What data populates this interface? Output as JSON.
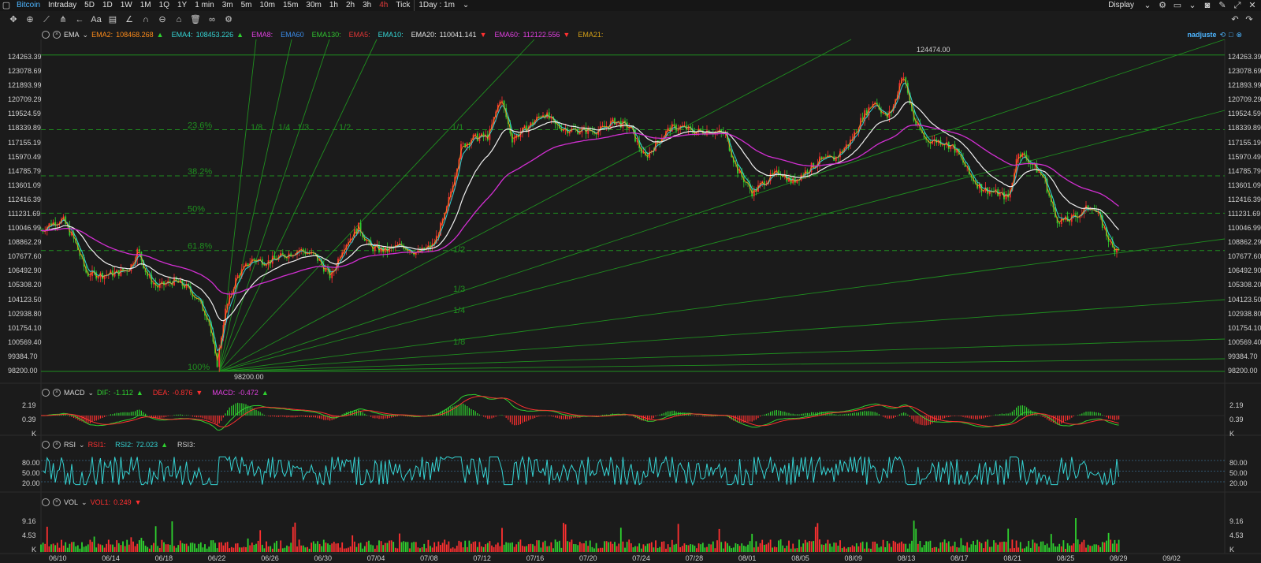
{
  "topbar": {
    "title": "Bitcoin",
    "intervals": [
      "Intraday",
      "5D",
      "1D",
      "1W",
      "1M",
      "1Q",
      "1Y",
      "1 min",
      "3m",
      "5m",
      "10m",
      "15m",
      "30m",
      "1h",
      "2h",
      "3h",
      "4h",
      "Tick"
    ],
    "active_interval": "4h",
    "range_select": "1Day : 1m",
    "display_label": "Display"
  },
  "main_indicator": {
    "name": "EMA",
    "items": [
      {
        "label": "EMA2:",
        "value": "108468.268",
        "color": "#ff8c1a",
        "arrow": "▲"
      },
      {
        "label": "EMA4:",
        "value": "108453.226",
        "color": "#35d3d3",
        "arrow": "▲"
      },
      {
        "label": "EMA8:",
        "value": "",
        "color": "#e040e0",
        "arrow": ""
      },
      {
        "label": "EMA60",
        "value": "",
        "color": "#3a8be8",
        "arrow": ""
      },
      {
        "label": "EMA130:",
        "value": "",
        "color": "#30c030",
        "arrow": ""
      },
      {
        "label": "EMA5:",
        "value": "",
        "color": "#e03535",
        "arrow": ""
      },
      {
        "label": "EMA10:",
        "value": "",
        "color": "#35d3d3",
        "arrow": ""
      },
      {
        "label": "EMA20:",
        "value": "110041.141",
        "color": "#e0e0e0",
        "arrow": "▼"
      },
      {
        "label": "EMA60:",
        "value": "112122.556",
        "color": "#e040e0",
        "arrow": "▼"
      },
      {
        "label": "EMA21:",
        "value": "",
        "color": "#d4a017",
        "arrow": ""
      }
    ],
    "user": "nadjuste"
  },
  "price_axis": [
    "124263.39",
    "123078.69",
    "121893.99",
    "120709.29",
    "119524.59",
    "118339.89",
    "117155.19",
    "115970.49",
    "114785.79",
    "113601.09",
    "112416.39",
    "111231.69",
    "110046.99",
    "108862.29",
    "107677.60",
    "106492.90",
    "105308.20",
    "104123.50",
    "102938.80",
    "101754.10",
    "100569.40",
    "99384.70",
    "98200.00"
  ],
  "high_label": "124474.00",
  "low_label": "98200.00",
  "fib_labels": [
    "23.6%",
    "38.2%",
    "50%",
    "61.8%",
    "100%"
  ],
  "fan_labels_top": [
    "1/8",
    "1/4",
    "1/3",
    "1/2",
    "1/1"
  ],
  "fan_labels_side": [
    "1/2",
    "1/3",
    "1/4",
    "1/8"
  ],
  "macd": {
    "name": "MACD",
    "dif_label": "DIF:",
    "dif_value": "-1.112",
    "dea_label": "DEA:",
    "dea_value": "-0.876",
    "macd_label": "MACD:",
    "macd_value": "-0.472",
    "axis": [
      "2.19",
      "0.39",
      "K"
    ]
  },
  "rsi": {
    "name": "RSI",
    "rsi1_label": "RSI1:",
    "rsi2_label": "RSI2:",
    "rsi2_value": "72.023",
    "rsi3_label": "RSI3:",
    "axis": [
      "80.00",
      "50.00",
      "20.00"
    ]
  },
  "vol": {
    "name": "VOL",
    "vol1_label": "VOL1:",
    "vol1_value": "0.249",
    "axis": [
      "9.16",
      "4.53",
      "K"
    ]
  },
  "dates": [
    "06/10",
    "06/14",
    "06/18",
    "06/22",
    "06/26",
    "06/30",
    "07/04",
    "07/08",
    "07/12",
    "07/16",
    "07/20",
    "07/24",
    "07/28",
    "08/01",
    "08/05",
    "08/09",
    "08/13",
    "08/17",
    "08/21",
    "08/25",
    "08/29",
    "09/02"
  ],
  "colors": {
    "up": "#ff3030",
    "down": "#2fd12f",
    "bg": "#1b1b1b",
    "fib": "#1f8f1f"
  }
}
